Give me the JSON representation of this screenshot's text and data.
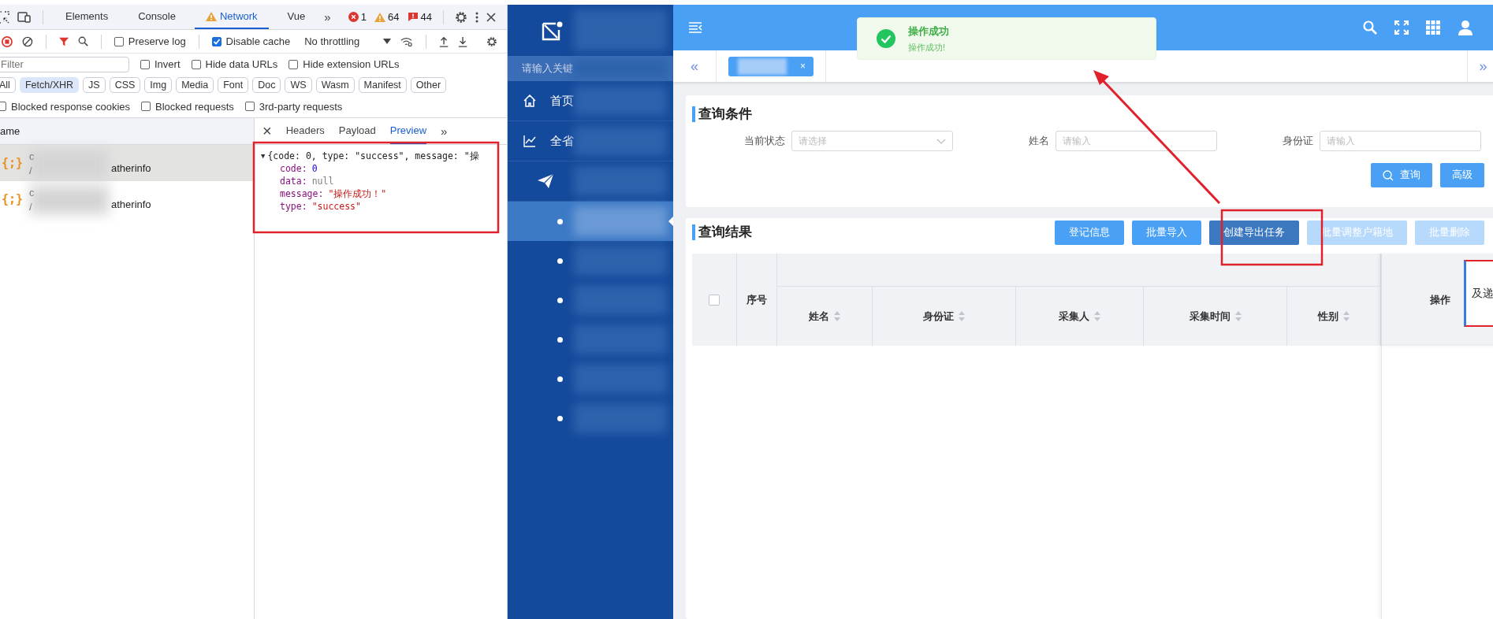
{
  "devtools": {
    "tabs": [
      {
        "label": "Elements",
        "selected": false,
        "warning": false
      },
      {
        "label": "Console",
        "selected": false,
        "warning": false
      },
      {
        "label": "Network",
        "selected": true,
        "warning": true
      },
      {
        "label": "Vue",
        "selected": false,
        "warning": false
      }
    ],
    "more": "»",
    "errors": "1",
    "warnings": "64",
    "issues": "44",
    "preserve_log": {
      "label": "Preserve log",
      "checked": false
    },
    "disable_cache": {
      "label": "Disable cache",
      "checked": true
    },
    "throttling": "No throttling",
    "filter_placeholder": "Filter",
    "filter_options": [
      {
        "label": "Invert",
        "checked": false
      },
      {
        "label": "Hide data URLs",
        "checked": false
      },
      {
        "label": "Hide extension URLs",
        "checked": false
      }
    ],
    "types": [
      {
        "label": "All",
        "selected": false
      },
      {
        "label": "Fetch/XHR",
        "selected": true
      },
      {
        "label": "JS",
        "selected": false
      },
      {
        "label": "CSS",
        "selected": false
      },
      {
        "label": "Img",
        "selected": false
      },
      {
        "label": "Media",
        "selected": false
      },
      {
        "label": "Font",
        "selected": false
      },
      {
        "label": "Doc",
        "selected": false
      },
      {
        "label": "WS",
        "selected": false
      },
      {
        "label": "Wasm",
        "selected": false
      },
      {
        "label": "Manifest",
        "selected": false
      },
      {
        "label": "Other",
        "selected": false
      }
    ],
    "blocked_options": [
      {
        "label": "Blocked response cookies",
        "checked": false
      },
      {
        "label": "Blocked requests",
        "checked": false
      },
      {
        "label": "3rd-party requests",
        "checked": false
      }
    ],
    "name_header": "ame",
    "requests": [
      {
        "icon": "{;}",
        "name": "c",
        "path": "/",
        "tail": "atherinfo",
        "selected": true
      },
      {
        "icon": "{;}",
        "name": "c",
        "path": "/",
        "tail": "atherinfo",
        "selected": false
      }
    ],
    "detail_close": "×",
    "detail_tabs": [
      {
        "label": "Headers",
        "selected": false
      },
      {
        "label": "Payload",
        "selected": false
      },
      {
        "label": "Preview",
        "selected": true
      }
    ],
    "detail_more": "»",
    "preview": {
      "toggle": "▼",
      "summary": "{code: 0, type: \"success\", message: \"操",
      "fields": [
        {
          "key": "code:",
          "value": "0",
          "kind": "number"
        },
        {
          "key": "data:",
          "value": "null",
          "kind": "null"
        },
        {
          "key": "message:",
          "value": "\"操作成功！\"",
          "kind": "string"
        },
        {
          "key": "type:",
          "value": "\"success\"",
          "kind": "string"
        }
      ]
    }
  },
  "sidebar": {
    "search_placeholder": "请输入关键",
    "menu": [
      {
        "label": "首页"
      },
      {
        "label": "全省"
      },
      {
        "children": [
          {
            "selected": true
          },
          {
            "selected": false
          },
          {
            "selected": false
          },
          {
            "selected": false
          },
          {
            "selected": false
          },
          {
            "selected": false
          }
        ]
      }
    ]
  },
  "main": {
    "nav_prev": "«",
    "nav_next": "»",
    "tabs": [
      {
        "close": "×",
        "selected": true
      }
    ],
    "toast": {
      "title": "操作成功",
      "message": "操作成功!"
    },
    "query": {
      "title": "查询条件",
      "fields": [
        {
          "label": "当前状态",
          "placeholder": "请选择",
          "kind": "select"
        },
        {
          "label": "姓名",
          "placeholder": "请输入",
          "kind": "input"
        },
        {
          "label": "身份证",
          "placeholder": "请输入",
          "kind": "input"
        }
      ],
      "buttons": [
        {
          "label": "查询",
          "kind": "search"
        },
        {
          "label": "高级",
          "kind": "plain"
        }
      ]
    },
    "results": {
      "title": "查询结果",
      "buttons": [
        {
          "label": "登记信息",
          "disabled": false,
          "focused": false
        },
        {
          "label": "批量导入",
          "disabled": false,
          "focused": false
        },
        {
          "label": "创建导出任务",
          "disabled": false,
          "focused": true
        },
        {
          "label": "批量调整户籍地",
          "disabled": true,
          "focused": false
        },
        {
          "label": "批量删除",
          "disabled": true,
          "focused": false
        }
      ],
      "select_all_checked": false,
      "index_label": "序号",
      "columns": [
        {
          "label": "姓名",
          "sortable": true
        },
        {
          "label": "身份证",
          "sortable": true
        },
        {
          "label": "采集人",
          "sortable": true
        },
        {
          "label": "采集时间",
          "sortable": true
        },
        {
          "label": "性别",
          "sortable": true
        }
      ],
      "actions_label": "操作"
    },
    "edge_popup": "及递"
  },
  "annotations": [
    {
      "kind": "box"
    },
    {
      "kind": "box"
    },
    {
      "kind": "arrow"
    }
  ]
}
